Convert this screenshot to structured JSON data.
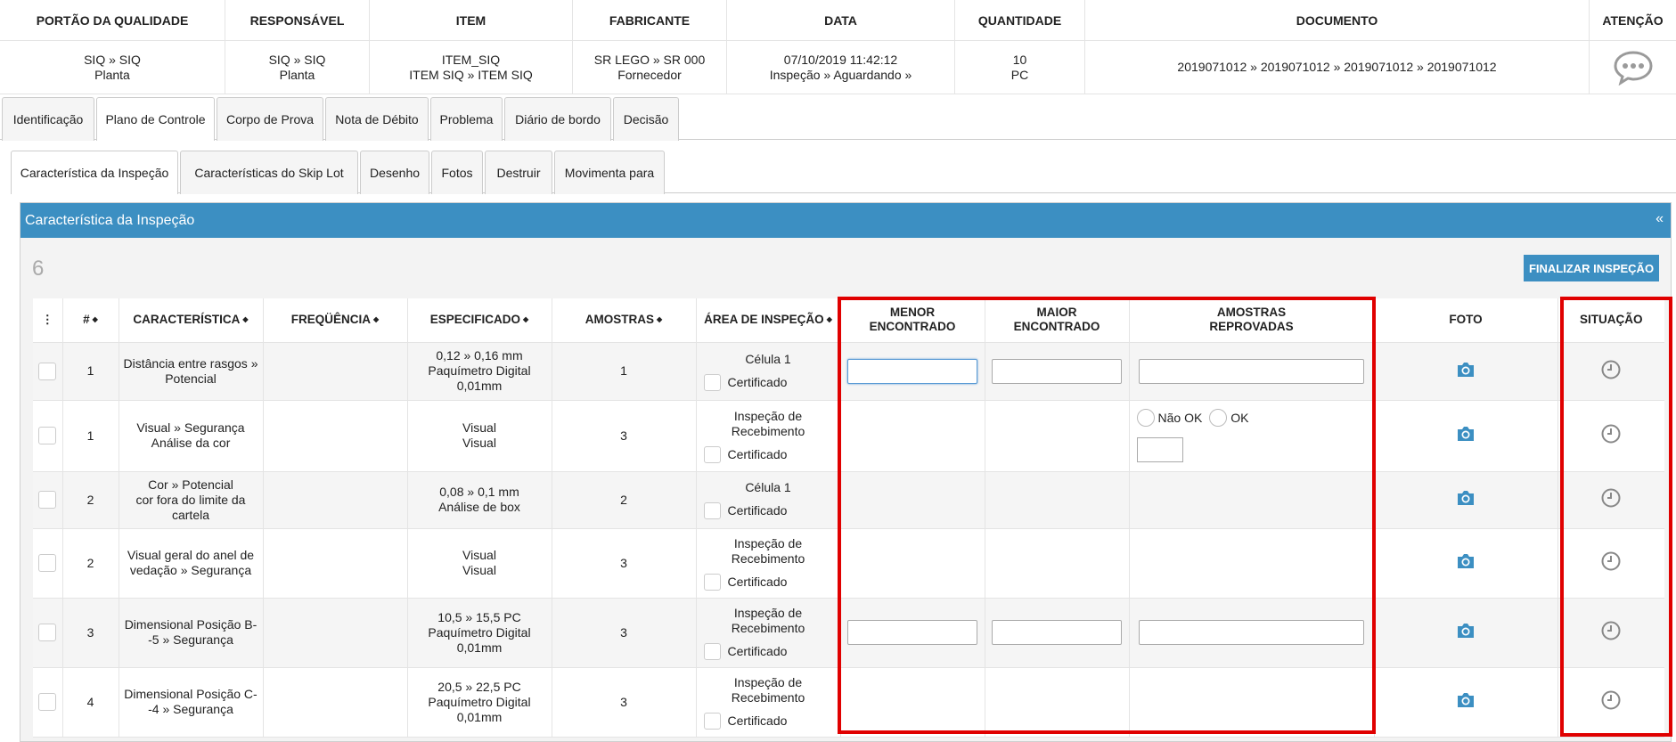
{
  "header": {
    "columns": [
      {
        "title": "PORTÃO DA QUALIDADE",
        "line1": "SIQ » SIQ",
        "line2": "Planta"
      },
      {
        "title": "RESPONSÁVEL",
        "line1": "SIQ » SIQ",
        "line2": "Planta"
      },
      {
        "title": "ITEM",
        "line1": "ITEM_SIQ",
        "line2": "ITEM SIQ » ITEM SIQ"
      },
      {
        "title": "FABRICANTE",
        "line1": "SR LEGO » SR 000",
        "line2": "Fornecedor"
      },
      {
        "title": "DATA",
        "line1": "07/10/2019 11:42:12",
        "line2": "Inspeção » Aguardando »"
      },
      {
        "title": "QUANTIDADE",
        "line1": "10",
        "line2": "PC"
      },
      {
        "title": "DOCUMENTO",
        "line1": "2019071012 » 2019071012 » 2019071012 » 2019071012",
        "line2": ""
      },
      {
        "title": "ATENÇÃO",
        "icon": "speech-bubble-icon"
      }
    ]
  },
  "tabs_main": [
    "Identificação",
    "Plano de Controle",
    "Corpo de Prova",
    "Nota de Débito",
    "Problema",
    "Diário de bordo",
    "Decisão"
  ],
  "tabs_main_active": "Plano de Controle",
  "tabs_sub": [
    "Característica da Inspeção",
    "Características do Skip Lot",
    "Desenho",
    "Fotos",
    "Destruir",
    "Movimenta para"
  ],
  "tabs_sub_active": "Característica da Inspeção",
  "panel": {
    "title": "Característica da Inspeção",
    "collapse": "«",
    "count": "6",
    "finish_button": "FINALIZAR INSPEÇÃO"
  },
  "table": {
    "headers": {
      "menu": "⋮",
      "num": "#",
      "caracteristica": "CARACTERÍSTICA",
      "frequencia": "FREQÜÊNCIA",
      "especificado": "ESPECIFICADO",
      "amostras": "AMOSTRAS",
      "area": "ÁREA DE INSPEÇÃO",
      "menor_1": "MENOR",
      "menor_2": "ENCONTRADO",
      "maior_1": "MAIOR",
      "maior_2": "ENCONTRADO",
      "reprov_1": "AMOSTRAS",
      "reprov_2": "REPROVADAS",
      "foto": "FOTO",
      "situacao": "SITUAÇÃO"
    },
    "certificado": "Certificado",
    "radio_nok": "Não OK",
    "radio_ok": "OK",
    "rows": [
      {
        "num": "1",
        "car_1": "Distância entre rasgos »",
        "car_2": "Potencial",
        "car_3": "",
        "esp_1": "0,12 » 0,16 mm",
        "esp_2": "Paquímetro Digital",
        "esp_3": "0,01mm",
        "amostras": "1",
        "area_1": "Célula 1",
        "area_2": ""
      },
      {
        "num": "1",
        "car_1": "Visual » Segurança",
        "car_2": "Análise da cor",
        "car_3": "",
        "esp_1": "Visual",
        "esp_2": "Visual",
        "esp_3": "",
        "amostras": "3",
        "area_1": "Inspeção de",
        "area_2": "Recebimento"
      },
      {
        "num": "2",
        "car_1": "Cor » Potencial",
        "car_2": "cor fora do limite da",
        "car_3": "cartela",
        "esp_1": "0,08 » 0,1 mm",
        "esp_2": "Análise de box",
        "esp_3": "",
        "amostras": "2",
        "area_1": "Célula 1",
        "area_2": ""
      },
      {
        "num": "2",
        "car_1": "Visual geral do anel de",
        "car_2": "vedação » Segurança",
        "car_3": "",
        "esp_1": "Visual",
        "esp_2": "Visual",
        "esp_3": "",
        "amostras": "3",
        "area_1": "Inspeção de",
        "area_2": "Recebimento"
      },
      {
        "num": "3",
        "car_1": "Dimensional Posição B-",
        "car_2": "-5 » Segurança",
        "car_3": "",
        "esp_1": "10,5 » 15,5 PC",
        "esp_2": "Paquímetro Digital",
        "esp_3": "0,01mm",
        "amostras": "3",
        "area_1": "Inspeção de",
        "area_2": "Recebimento"
      },
      {
        "num": "4",
        "car_1": "Dimensional Posição C-",
        "car_2": "-4 » Segurança",
        "car_3": "",
        "esp_1": "20,5 » 22,5 PC",
        "esp_2": "Paquímetro Digital",
        "esp_3": "0,01mm",
        "amostras": "3",
        "area_1": "Inspeção de",
        "area_2": "Recebimento"
      }
    ]
  },
  "colors": {
    "accent": "#3c8fc2",
    "highlight": "#e00000",
    "icon_blue": "#3c8fc2",
    "icon_gray": "#888888"
  }
}
